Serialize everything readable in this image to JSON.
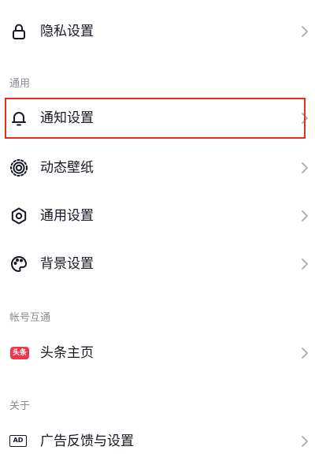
{
  "settings": {
    "privacy": {
      "label": "隐私设置",
      "icon": "lock-icon"
    },
    "sections": {
      "general": {
        "title": "通用"
      },
      "account": {
        "title": "帐号互通"
      },
      "about": {
        "title": "关于"
      }
    },
    "items": {
      "notification": {
        "label": "通知设置",
        "icon": "bell-icon",
        "highlighted": true
      },
      "live_wallpaper": {
        "label": "动态壁纸",
        "icon": "live-wallpaper-icon"
      },
      "general_settings": {
        "label": "通用设置",
        "icon": "gear-icon"
      },
      "background": {
        "label": "背景设置",
        "icon": "palette-icon"
      },
      "toutiao": {
        "label": "头条主页",
        "badge": "头条",
        "icon": "toutiao-badge-icon"
      },
      "ads": {
        "label": "广告反馈与设置",
        "icon_text": "AD",
        "icon": "ad-icon"
      }
    }
  },
  "colors": {
    "text": "#161823",
    "section_header": "#8a8b91",
    "chevron": "#a8a9ad",
    "highlight_border": "#e0321f",
    "toutiao_badge": "#f2334e"
  }
}
